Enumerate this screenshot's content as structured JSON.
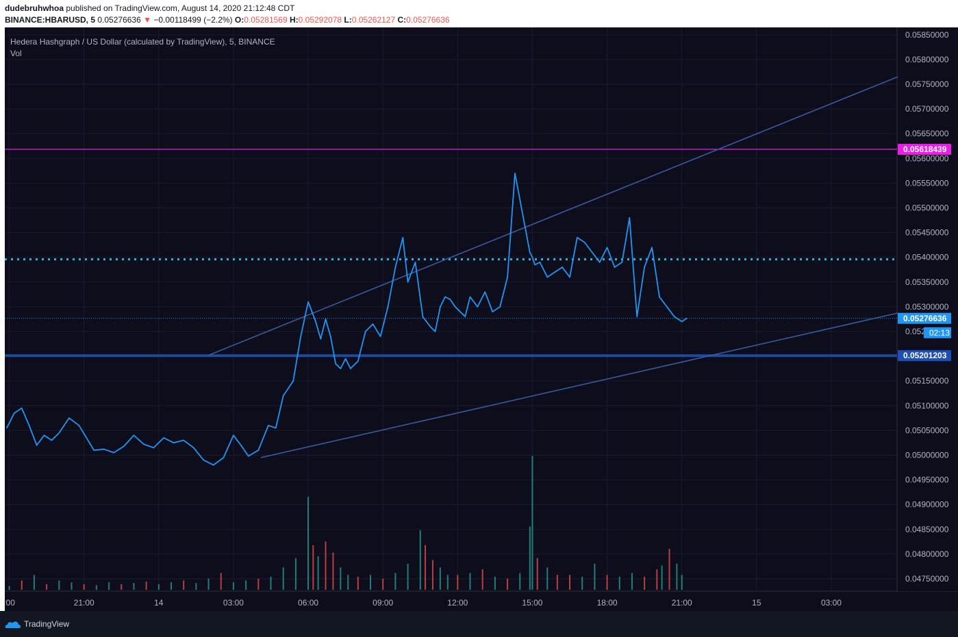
{
  "header": {
    "author": "dudebruhwhoa",
    "published_text": "published on TradingView.com, August 14, 2020 21:12:48 CDT",
    "symbol": "BINANCE:HBARUSD, 5",
    "last": "0.05276636",
    "change": "−0.00118499 (−2.2%)",
    "o_label": "O:",
    "o_value": "0.05281569",
    "h_label": "H:",
    "h_value": "0.05292078",
    "l_label": "L:",
    "l_value": "0.05262127",
    "c_label": "C:",
    "c_value": "0.05276636"
  },
  "legend": {
    "title": "Hedera Hashgraph / US Dollar (calculated by TradingView), 5, BINANCE",
    "volume": "Vol"
  },
  "footer": {
    "brand": "TradingView"
  },
  "colors": {
    "background": "#0d0d1c",
    "price_line": "#2196f3",
    "volume_up": "#26a69a",
    "volume_down": "#ef5350",
    "trendline": "#3a5aa0",
    "magenta_level": "#e91ee9",
    "dotted_level": "#2bb8e0",
    "support_level": "#1e4a9e",
    "label_last": "#2196f3",
    "label_support": "#1e4fb8"
  },
  "chart_data": {
    "type": "line",
    "title": "Hedera Hashgraph / US Dollar (calculated by TradingView), 5, BINANCE",
    "y_ticks": [
      "0.04750000",
      "0.04800000",
      "0.04850000",
      "0.04900000",
      "0.04950000",
      "0.05000000",
      "0.05050000",
      "0.05100000",
      "0.05150000",
      "0.05200000",
      "0.05250000",
      "0.05300000",
      "0.05350000",
      "0.05400000",
      "0.05450000",
      "0.05500000",
      "0.05550000",
      "0.05600000",
      "0.05650000",
      "0.05700000",
      "0.05750000",
      "0.05800000",
      "0.05850000"
    ],
    "y_tick_values": [
      0.0475,
      0.048,
      0.0485,
      0.049,
      0.0495,
      0.05,
      0.0505,
      0.051,
      0.0515,
      0.052,
      0.0525,
      0.053,
      0.0535,
      0.054,
      0.0545,
      0.055,
      0.0555,
      0.056,
      0.0565,
      0.057,
      0.0575,
      0.058,
      0.0585
    ],
    "ylim": [
      0.04725,
      0.05865
    ],
    "x_ticks": [
      ":00",
      "21:00",
      "14",
      "03:00",
      "06:00",
      "09:00",
      "12:00",
      "15:00",
      "18:00",
      "21:00",
      "15",
      "03:00"
    ],
    "x_tick_hours": [
      18,
      21,
      24,
      27,
      30,
      33,
      36,
      39,
      42,
      45,
      48,
      51
    ],
    "xlim": [
      17.82,
      53.64
    ],
    "price_series": {
      "name": "HBARUSD",
      "x_hours": [
        17.9,
        18.2,
        18.5,
        18.8,
        19.1,
        19.4,
        19.7,
        20.0,
        20.4,
        20.8,
        21.1,
        21.4,
        21.8,
        22.2,
        22.6,
        23.0,
        23.4,
        23.8,
        24.2,
        24.6,
        25.0,
        25.4,
        25.8,
        26.2,
        26.6,
        27.0,
        27.3,
        27.6,
        28.0,
        28.4,
        28.7,
        29.0,
        29.4,
        29.7,
        30.0,
        30.3,
        30.5,
        30.7,
        30.9,
        31.1,
        31.3,
        31.5,
        31.7,
        32.0,
        32.3,
        32.6,
        32.9,
        33.2,
        33.5,
        33.8,
        34.0,
        34.3,
        34.6,
        34.9,
        35.1,
        35.3,
        35.5,
        35.7,
        35.9,
        36.1,
        36.3,
        36.5,
        36.8,
        37.1,
        37.4,
        37.7,
        38.0,
        38.3,
        38.6,
        38.9,
        39.0,
        39.1,
        39.3,
        39.6,
        39.9,
        40.2,
        40.5,
        40.8,
        41.1,
        41.4,
        41.7,
        42.0,
        42.3,
        42.6,
        42.9,
        43.2,
        43.5,
        43.8,
        44.1,
        44.4,
        44.7,
        45.0,
        45.2
      ],
      "values": [
        0.05055,
        0.05085,
        0.05095,
        0.0506,
        0.0502,
        0.0504,
        0.0503,
        0.05045,
        0.05075,
        0.0506,
        0.05035,
        0.0501,
        0.05012,
        0.05005,
        0.05018,
        0.0504,
        0.05022,
        0.05015,
        0.05035,
        0.05025,
        0.0503,
        0.05015,
        0.0499,
        0.0498,
        0.04995,
        0.0504,
        0.0502,
        0.04998,
        0.0501,
        0.0506,
        0.05055,
        0.0512,
        0.0515,
        0.0524,
        0.0531,
        0.0527,
        0.05235,
        0.05275,
        0.0524,
        0.05185,
        0.05175,
        0.05195,
        0.05175,
        0.0519,
        0.0525,
        0.05265,
        0.0524,
        0.053,
        0.0538,
        0.0544,
        0.0535,
        0.0539,
        0.0528,
        0.0526,
        0.0525,
        0.053,
        0.0532,
        0.05315,
        0.053,
        0.0529,
        0.0528,
        0.0532,
        0.053,
        0.0533,
        0.0529,
        0.053,
        0.0536,
        0.0557,
        0.0549,
        0.0541,
        0.054,
        0.05385,
        0.0539,
        0.0536,
        0.0537,
        0.0538,
        0.0536,
        0.0544,
        0.0543,
        0.0541,
        0.0539,
        0.0542,
        0.0538,
        0.0539,
        0.0548,
        0.0528,
        0.0538,
        0.0542,
        0.0532,
        0.053,
        0.0528,
        0.0527,
        0.05276636
      ]
    },
    "volume_series": {
      "name": "Vol",
      "x_hours": [
        18.0,
        18.5,
        19.0,
        19.5,
        20.0,
        20.5,
        21.0,
        21.5,
        22.0,
        22.5,
        23.0,
        23.5,
        24.0,
        24.5,
        25.0,
        25.5,
        26.0,
        26.5,
        27.0,
        27.5,
        28.0,
        28.5,
        29.0,
        29.5,
        30.0,
        30.2,
        30.4,
        30.7,
        31.0,
        31.3,
        31.6,
        32.0,
        32.5,
        33.0,
        33.5,
        34.0,
        34.5,
        34.7,
        35.0,
        35.3,
        35.6,
        36.0,
        36.5,
        37.0,
        37.5,
        38.0,
        38.5,
        38.9,
        39.0,
        39.2,
        39.6,
        40.0,
        40.5,
        41.0,
        41.5,
        42.0,
        42.5,
        43.0,
        43.5,
        44.0,
        44.2,
        44.5,
        44.8,
        45.0
      ],
      "values": [
        10,
        25,
        40,
        15,
        25,
        20,
        15,
        12,
        20,
        15,
        18,
        22,
        15,
        20,
        25,
        18,
        30,
        45,
        20,
        25,
        30,
        35,
        60,
        85,
        250,
        120,
        90,
        130,
        100,
        60,
        40,
        35,
        40,
        30,
        45,
        70,
        160,
        120,
        80,
        60,
        40,
        40,
        45,
        55,
        35,
        30,
        45,
        170,
        360,
        85,
        60,
        40,
        40,
        35,
        70,
        40,
        35,
        45,
        35,
        55,
        65,
        110,
        70,
        40
      ],
      "colors": [
        "u",
        "d",
        "u",
        "d",
        "u",
        "u",
        "d",
        "u",
        "u",
        "d",
        "u",
        "d",
        "u",
        "u",
        "d",
        "u",
        "u",
        "d",
        "u",
        "u",
        "d",
        "u",
        "u",
        "u",
        "u",
        "d",
        "u",
        "d",
        "d",
        "u",
        "u",
        "d",
        "u",
        "d",
        "u",
        "u",
        "u",
        "d",
        "d",
        "u",
        "u",
        "d",
        "u",
        "d",
        "u",
        "d",
        "u",
        "u",
        "u",
        "d",
        "u",
        "d",
        "d",
        "u",
        "u",
        "d",
        "u",
        "u",
        "d",
        "d",
        "u",
        "d",
        "u",
        "u"
      ],
      "ylim": [
        0,
        420
      ]
    },
    "trendlines": [
      {
        "name": "upper-channel",
        "from": [
          26.0,
          0.05202
        ],
        "to": [
          54.4,
          0.0578
        ]
      },
      {
        "name": "lower-channel",
        "from": [
          28.1,
          0.04995
        ],
        "to": [
          57.4,
          0.0533
        ]
      }
    ],
    "horizontal_levels": [
      {
        "name": "magenta-level",
        "value": 0.05618439,
        "label": "0.05618439",
        "style": "solid"
      },
      {
        "name": "dotted-level",
        "value": 0.05396,
        "label": "",
        "style": "dotted"
      },
      {
        "name": "last-price-level",
        "value": 0.05276636,
        "label": "0.05276636",
        "style": "dotted-thin"
      },
      {
        "name": "support-level",
        "value": 0.05201203,
        "label": "0.05201203",
        "style": "thick"
      }
    ],
    "countdown": "02:13",
    "grid": true
  }
}
